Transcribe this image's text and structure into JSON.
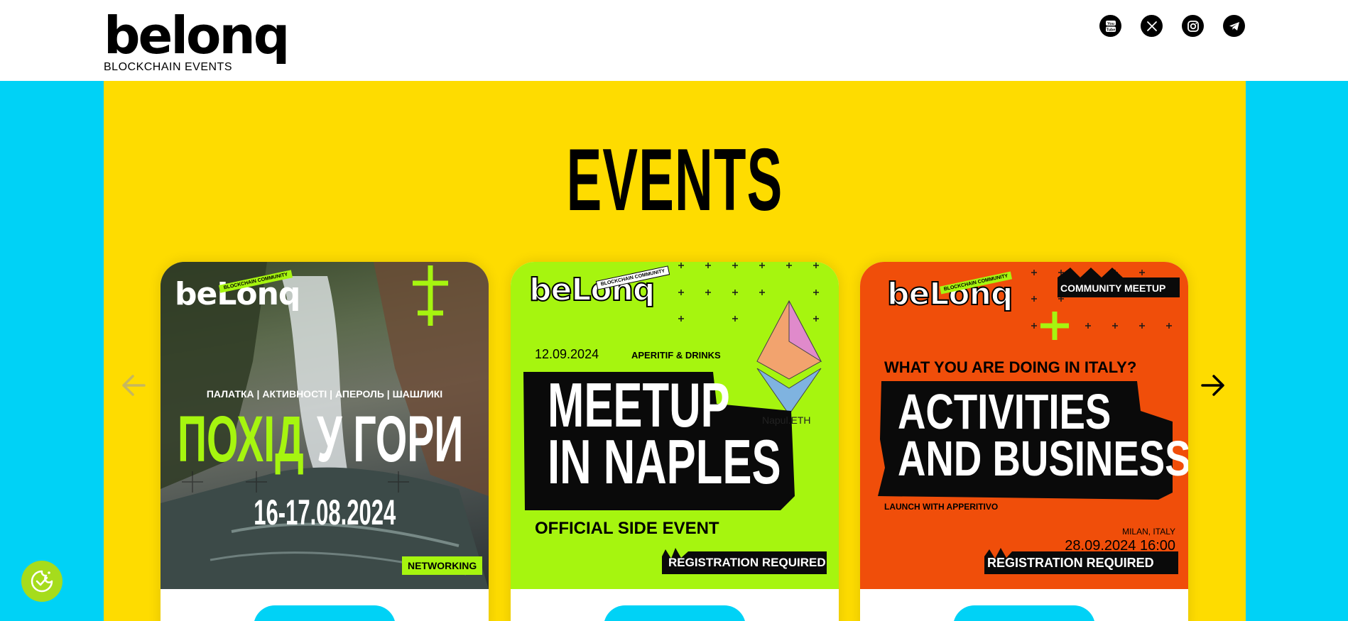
{
  "header": {
    "logo_word": "belonq",
    "logo_sub": "BLOCKCHAIN EVENTS",
    "socials": [
      {
        "name": "youtube-icon"
      },
      {
        "name": "x-twitter-icon"
      },
      {
        "name": "instagram-icon"
      },
      {
        "name": "telegram-icon"
      }
    ]
  },
  "main": {
    "title": "EVENTS"
  },
  "colors": {
    "page_bg": "#00d2f6",
    "stage_bg": "#fedc00",
    "accent_green": "#a6f50f",
    "accent_orange": "#f04e0a"
  },
  "cards": [
    {
      "brand": "beLonq",
      "tag": "BLOCKCHAIN COMMUNITY",
      "subtitle": "ПАЛАТКА | АКТИВНОСТІ | АПЕРОЛЬ | ШАШЛИКІ",
      "headline_a": "ПОХІД",
      "headline_b": "У ГОРИ",
      "date": "16-17.08.2024",
      "badge": "NETWORKING"
    },
    {
      "brand": "beLonq",
      "tag": "BLOCKCHAIN COMMUNITY",
      "date": "12.09.2024",
      "extra": "APERITIF & DRINKS",
      "headline_a": "MEETUP",
      "headline_b": "IN NAPLES",
      "sponsor": "Napul.ETH",
      "subheadline": "OFFICIAL SIDE EVENT",
      "badge": "REGISTRATION REQUIRED"
    },
    {
      "brand": "beLonq",
      "tag": "BLOCKCHAIN COMMUNITY",
      "pill": "COMMUNITY  MEETUP",
      "question": "WHAT YOU ARE DOING IN ITALY?",
      "headline_a": "ACTIVITIES",
      "headline_b": "AND BUSINESS",
      "launch": "LAUNCH WITH APPERITIVO",
      "location": "MILAN, ITALY",
      "datetime": "28.09.2024 16:00",
      "badge": "REGISTRATION REQUIRED"
    }
  ]
}
